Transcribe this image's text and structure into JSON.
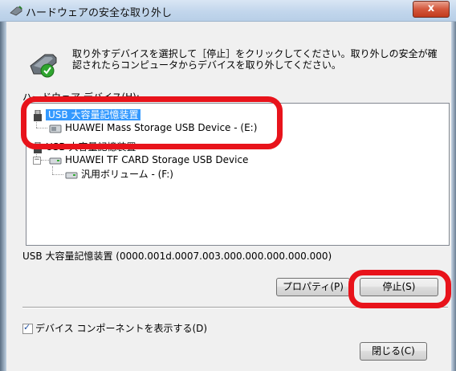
{
  "window": {
    "title": "ハードウェアの安全な取り外し",
    "close_label": "x"
  },
  "instructions": "取り外すデバイスを選択して［停止］をクリックしてください。取り外しの安全が確認されたらコンピュータからデバイスを取り外してください。",
  "device_list": {
    "label": "ハードウェア デバイス(H):",
    "items": [
      {
        "label": "USB 大容量記憶装置",
        "level": 0,
        "selected": true
      },
      {
        "label": "HUAWEI Mass Storage USB Device - (E:)",
        "level": 1,
        "selected": false
      },
      {
        "label": "USB 大容量記憶装置",
        "level": 0,
        "selected": false
      },
      {
        "label": "HUAWEI TF CARD Storage USB Device",
        "level": 1,
        "selected": false
      },
      {
        "label": "汎用ボリューム - (F:)",
        "level": 2,
        "selected": false
      }
    ]
  },
  "selected_device_status": "USB 大容量記憶装置 (0000.001d.0007.003.000.000.000.000.000)",
  "buttons": {
    "properties": "プロパティ(P)",
    "stop": "停止(S)",
    "close": "閉じる(C)"
  },
  "options": {
    "show_components_label": "デバイス コンポーネントを表示する(D)",
    "show_components_checked": true
  },
  "colors": {
    "highlight": "#e8131b",
    "selection": "#3399ff"
  }
}
